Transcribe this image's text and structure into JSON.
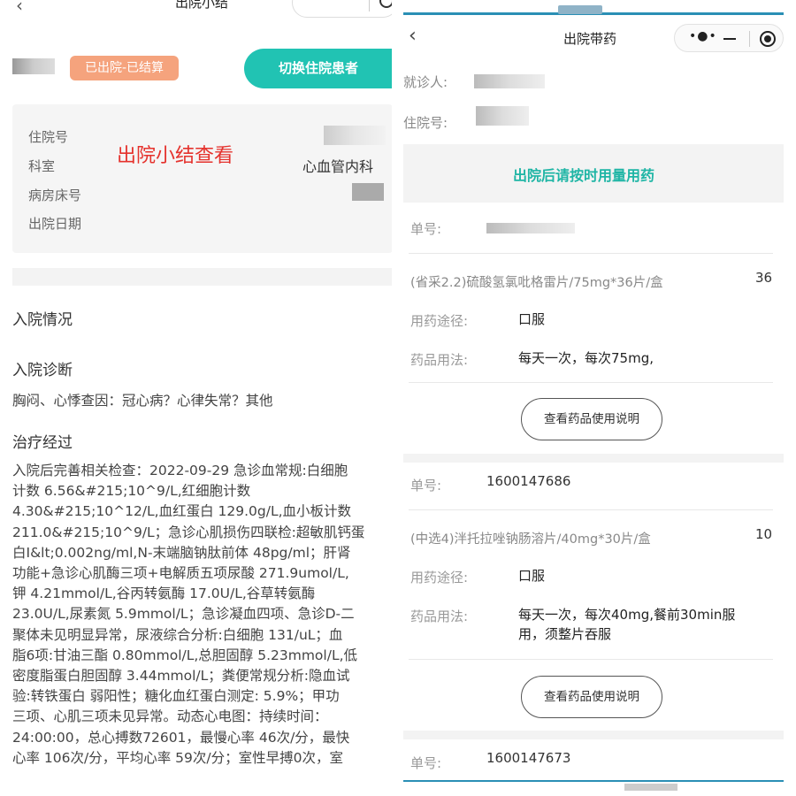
{
  "left": {
    "header": {
      "back_icon": "‹",
      "title": "出院小结"
    },
    "status_badge": "已出院-已结算",
    "switch_button": "切换住院患者",
    "info": {
      "labels": [
        "住院号",
        "科室",
        "病房床号",
        "出院日期"
      ],
      "overlay": "出院小结查看",
      "dept_value": "心血管内科"
    },
    "sections": {
      "admission_situation": "入院情况",
      "admission_diagnosis": "入院诊断",
      "diagnosis_text": "胸闷、心悸查因：冠心病？心律失常？其他",
      "treatment": "治疗经过"
    },
    "treatment_lines": [
      "入院后完善相关检查：2022-09-29 急诊血常规:白细胞",
      "计数 6.56&#215;10^9/L,红细胞计数",
      "4.30&#215;10^12/L,血红蛋白 129.0g/L,血小板计数",
      "211.0&#215;10^9/L；急诊心肌损伤四联检:超敏肌钙蛋",
      "白Ⅰ&lt;0.002ng/ml,N-末端脑钠肽前体 48pg/ml；肝肾",
      "功能+急诊心肌酶三项+电解质五项尿酸 271.9umol/L,",
      "钾 4.21mmol/L,谷丙转氨酶 17.0U/L,谷草转氨酶",
      "23.0U/L,尿素氮 5.9mmol/L；急诊凝血四项、急诊D-二",
      "聚体未见明显异常，尿液综合分析:白细胞 131/uL；血",
      "脂6项:甘油三酯 0.80mmol/L,总胆固醇 5.23mmol/L,低",
      "密度脂蛋白胆固醇 3.44mmol/L；粪便常规分析:隐血试",
      "验:转铁蛋白 弱阳性；糖化血红蛋白测定: 5.9%；甲功",
      "三项、心肌三项未见异常。动态心电图：持续时间：",
      "24:00:00，总心搏数72601，最慢心率 46次/分，最快",
      "心率 106次/分，平均心率 59次/分；室性早搏0次，室"
    ]
  },
  "right": {
    "header": {
      "back_icon": "‹",
      "title": "出院带药",
      "more_icon": "•●•"
    },
    "patient_label": "就诊人:",
    "inpatient_label": "住院号:",
    "notice": "出院后请按时用量用药",
    "orders": [
      {
        "order_label": "单号:",
        "order_no": "",
        "drug": "(省采2.2)硫酸氢氯吡格雷片/75mg*36片/盒",
        "qty": "36",
        "route_label": "用药途径:",
        "route": "口服",
        "usage_label": "药品用法:",
        "usage": "每天一次，每次75mg,",
        "button": "查看药品使用说明"
      },
      {
        "order_label": "单号:",
        "order_no": "1600147686",
        "drug": "(中选4)泮托拉唑钠肠溶片/40mg*30片/盒",
        "qty": "10",
        "route_label": "用药途径:",
        "route": "口服",
        "usage_label": "药品用法:",
        "usage_line1": "每天一次，每次40mg,餐前30min服",
        "usage_line2": "用，须整片吞服",
        "button": "查看药品使用说明"
      },
      {
        "order_label": "单号:",
        "order_no": "1600147673"
      }
    ]
  }
}
